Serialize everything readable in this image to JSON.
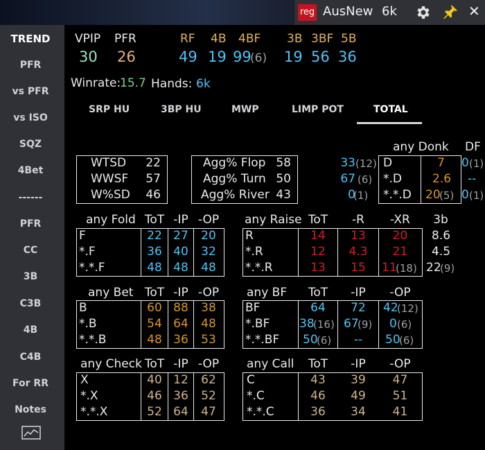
{
  "topbar": {
    "badge": "reg",
    "player": "AusNew",
    "stack": "6k"
  },
  "sidebar": {
    "items": [
      "TREND",
      "PFR",
      "vs PFR",
      "vs ISO",
      "SQZ",
      "4Bet",
      "------",
      "PFR",
      "CC",
      "3B",
      "C3B",
      "4B",
      "C4B",
      "For RR",
      "Notes"
    ]
  },
  "stats": {
    "vpip_label": "VPIP",
    "vpip": "30",
    "pfr_label": "PFR",
    "pfr": "26",
    "rf_label": "RF",
    "rf": "49",
    "b4_label": "4B",
    "b4": "19",
    "b4f_label": "4BF",
    "b4f": "99",
    "b4f_n": "(6)",
    "b3_label": "3B",
    "b3": "19",
    "b3f_label": "3BF",
    "b3f": "56",
    "b5_label": "5B",
    "b5": "36"
  },
  "summary": {
    "winrate_label": "Winrate:",
    "winrate": "15.7",
    "hands_label": "Hands:",
    "hands": "6k"
  },
  "tabs": [
    "SRP HU",
    "3BP HU",
    "MWP",
    "LIMP POT",
    "TOTAL"
  ],
  "showdown": {
    "rows": [
      [
        "WTSD",
        "22"
      ],
      [
        "WWSF",
        "57"
      ],
      [
        "W%SD",
        "46"
      ]
    ]
  },
  "aggression": {
    "rows": [
      [
        "Agg% Flop",
        "58"
      ],
      [
        "Agg% Turn",
        "50"
      ],
      [
        "Agg% River",
        "43"
      ]
    ]
  },
  "donk": {
    "header": "any Donk",
    "df_header": "DF",
    "left": [
      [
        "33",
        "(12)"
      ],
      [
        "67",
        "(6)"
      ],
      [
        "0",
        "(1)"
      ]
    ],
    "labels": [
      "D",
      "*.D",
      "*.*.D"
    ],
    "values": [
      [
        "7",
        ""
      ],
      [
        "2.6",
        ""
      ],
      [
        "20",
        "(5)"
      ]
    ],
    "df": [
      [
        "0",
        "(1)"
      ],
      [
        "--",
        ""
      ],
      [
        "0",
        "(1)"
      ]
    ]
  },
  "fold": {
    "header": "any Fold",
    "cols": [
      "ToT",
      "-IP",
      "-OP"
    ],
    "labels": [
      "F",
      "*.F",
      "*.*.F"
    ],
    "rows": [
      [
        "22",
        "27",
        "20"
      ],
      [
        "36",
        "40",
        "32"
      ],
      [
        "48",
        "48",
        "48"
      ]
    ]
  },
  "raise": {
    "header": "any Raise",
    "cols": [
      "ToT",
      "-R",
      "-XR",
      "3b"
    ],
    "labels": [
      "R",
      "*.R",
      "*.*.R"
    ],
    "rows": [
      [
        "14",
        "13",
        "20"
      ],
      [
        "12",
        "4.3",
        "21"
      ],
      [
        "13",
        "15",
        "11"
      ]
    ],
    "xr_sub": [
      "",
      "",
      "(18)"
    ],
    "b3": [
      [
        "8.6",
        ""
      ],
      [
        "4.5",
        ""
      ],
      [
        "22",
        "(9)"
      ]
    ]
  },
  "bet": {
    "header": "any Bet",
    "cols": [
      "ToT",
      "-IP",
      "-OP"
    ],
    "labels": [
      "B",
      "*.B",
      "*.*.B"
    ],
    "rows": [
      [
        "60",
        "88",
        "38"
      ],
      [
        "54",
        "64",
        "48"
      ],
      [
        "48",
        "36",
        "53"
      ]
    ]
  },
  "bf": {
    "header": "any BF",
    "cols": [
      "ToT",
      "-IP",
      "-OP"
    ],
    "labels": [
      "BF",
      "*.BF",
      "*.*.BF"
    ],
    "rows": [
      [
        "64",
        "",
        ""
      ],
      [
        "38",
        "(16)",
        ""
      ],
      [
        "50",
        "(6)",
        ""
      ]
    ],
    "ip": [
      [
        "72",
        ""
      ],
      [
        "67",
        "(9)"
      ],
      [
        "--",
        ""
      ]
    ],
    "op": [
      [
        "42",
        "(12)"
      ],
      [
        "0",
        "(6)"
      ],
      [
        "50",
        "(6)"
      ]
    ]
  },
  "check": {
    "header": "any Check",
    "cols": [
      "ToT",
      "-IP",
      "-OP"
    ],
    "labels": [
      "X",
      "*.X",
      "*.*.X"
    ],
    "rows": [
      [
        "40",
        "12",
        "62"
      ],
      [
        "46",
        "36",
        "52"
      ],
      [
        "52",
        "64",
        "47"
      ]
    ]
  },
  "call": {
    "header": "any Call",
    "cols": [
      "ToT",
      "-IP",
      "-OP"
    ],
    "labels": [
      "C",
      "*.C",
      "*.*.C"
    ],
    "rows": [
      [
        "43",
        "39",
        "47"
      ],
      [
        "46",
        "49",
        "51"
      ],
      [
        "36",
        "34",
        "41"
      ]
    ]
  },
  "colors": {
    "blue": "#4fc3f7",
    "red": "#d11f1f",
    "gold": "#d6962e",
    "tan": "#d2b48c",
    "green": "#98e5c0",
    "orange": "#e8b27a"
  }
}
